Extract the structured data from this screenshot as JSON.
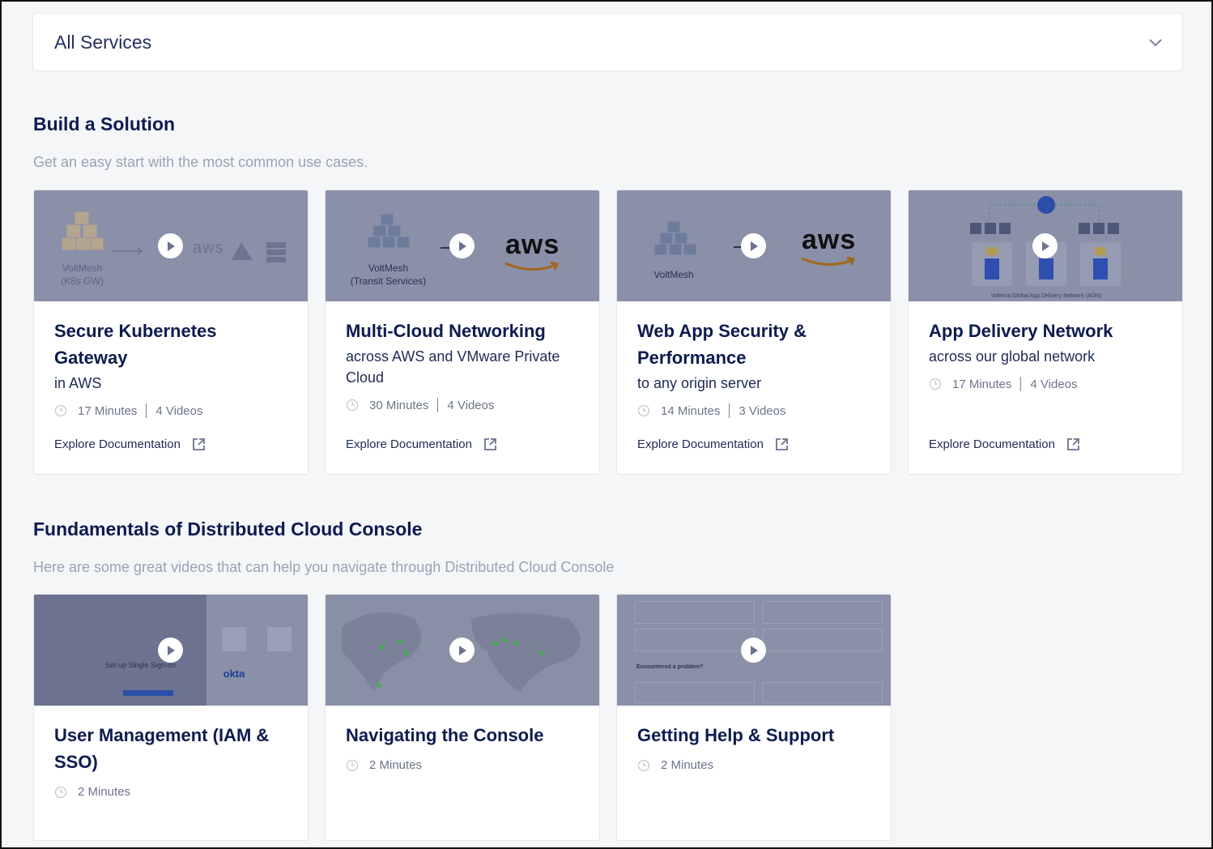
{
  "service_filter": {
    "value": "All Services"
  },
  "build": {
    "title": "Build a Solution",
    "subtitle": "Get an easy start with the most common use cases.",
    "cards": [
      {
        "title": "Secure Kubernetes Gateway",
        "subtitle": "in AWS",
        "duration": "17 Minutes",
        "videos": "4 Videos",
        "link": "Explore Documentation",
        "thumb_label": "VoltMesh\n(K8s GW)",
        "thumb_aws": "aws"
      },
      {
        "title": "Multi-Cloud Networking",
        "subtitle": "across AWS and VMware Private Cloud",
        "duration": "30 Minutes",
        "videos": "4 Videos",
        "link": "Explore Documentation",
        "thumb_label": "VoltMesh\n(Transit Services)",
        "thumb_aws": "aws"
      },
      {
        "title": "Web App Security & Performance",
        "subtitle": "to any origin server",
        "duration": "14 Minutes",
        "videos": "3 Videos",
        "link": "Explore Documentation",
        "thumb_label": "VoltMesh",
        "thumb_aws": "aws"
      },
      {
        "title": "App Delivery Network",
        "subtitle": "across our global network",
        "duration": "17 Minutes",
        "videos": "4 Videos",
        "link": "Explore Documentation",
        "thumb_label": "Volterra Global App Delivery Network (ADN)"
      }
    ]
  },
  "fundamentals": {
    "title": "Fundamentals of Distributed Cloud Console",
    "subtitle": "Here are some great videos that can help you navigate through Distributed Cloud Console",
    "cards": [
      {
        "title": "User Management (IAM & SSO)",
        "duration": "2 Minutes",
        "thumb_label": "Set up Single Sign-on",
        "thumb_okta": "okta"
      },
      {
        "title": "Navigating the Console",
        "duration": "2 Minutes"
      },
      {
        "title": "Getting Help & Support",
        "duration": "2 Minutes",
        "thumb_label": "Encountered a problem?"
      }
    ]
  },
  "colors": {
    "heading": "#0d1b4f",
    "thumb_overlay": "#8a90a8",
    "background": "#f5f6f8"
  }
}
